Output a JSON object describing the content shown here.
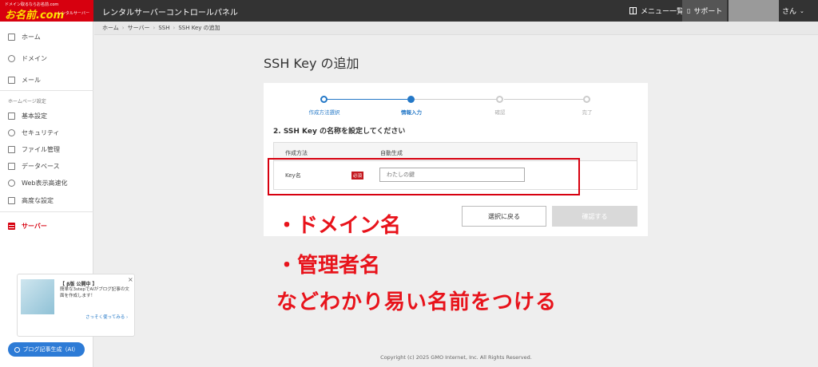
{
  "header": {
    "logo_tagline": "ドメイン取るならお名前.com",
    "logo_brand": "お名前.com",
    "logo_sub": "レンタルサーバー",
    "app_title": "レンタルサーバーコントロールパネル",
    "menu_label": "メニュー一覧",
    "support_label": "サポート",
    "user_suffix": "さん"
  },
  "sidebar": {
    "items": [
      {
        "label": "ホーム",
        "icon": "home-icon"
      },
      {
        "label": "ドメイン",
        "icon": "domain-icon"
      },
      {
        "label": "メール",
        "icon": "mail-icon"
      },
      {
        "label": "基本設定",
        "icon": "monitor-icon"
      },
      {
        "label": "セキュリティ",
        "icon": "shield-icon"
      },
      {
        "label": "ファイル管理",
        "icon": "file-icon"
      },
      {
        "label": "データベース",
        "icon": "database-icon"
      },
      {
        "label": "Web表示高速化",
        "icon": "speed-icon"
      },
      {
        "label": "高度な設定",
        "icon": "settings-icon"
      },
      {
        "label": "サーバー",
        "icon": "server-icon"
      }
    ],
    "section_label": "ホームページ設定",
    "active_item": "サーバー"
  },
  "promo": {
    "title": "【 β版 公開中 】",
    "text": "簡単な3stepでAIがブログ記事の文面を作成します！",
    "link": "さっそく使ってみる ›",
    "ai_button": "ブログ記事生成（AI）"
  },
  "breadcrumb": [
    "ホーム",
    "サーバー",
    "SSH",
    "SSH Key の追加"
  ],
  "main": {
    "page_title": "SSH Key の追加",
    "steps": [
      {
        "label": "作成方法選択",
        "state": "done"
      },
      {
        "label": "情報入力",
        "state": "current"
      },
      {
        "label": "確認",
        "state": "todo"
      },
      {
        "label": "完了",
        "state": "todo"
      }
    ],
    "section_title": "2. SSH Key の名称を設定してください",
    "row1_label": "作成方法",
    "row1_value": "自動生成",
    "row2_label": "Key名",
    "required_badge": "必須",
    "key_placeholder": "わたしの鍵",
    "back_button": "選択に戻る",
    "confirm_button": "確認する"
  },
  "annotations": {
    "line1": "・ドメイン名",
    "line2": "・管理者名",
    "line3": "などわかり易い名前をつける"
  },
  "footer": "Copyright (c) 2025 GMO Internet, Inc. All Rights Reserved.",
  "colors": {
    "brand_red": "#d7000f",
    "topbar": "#333333",
    "accent_blue": "#2478c7",
    "annotation_red": "#e8131b"
  }
}
